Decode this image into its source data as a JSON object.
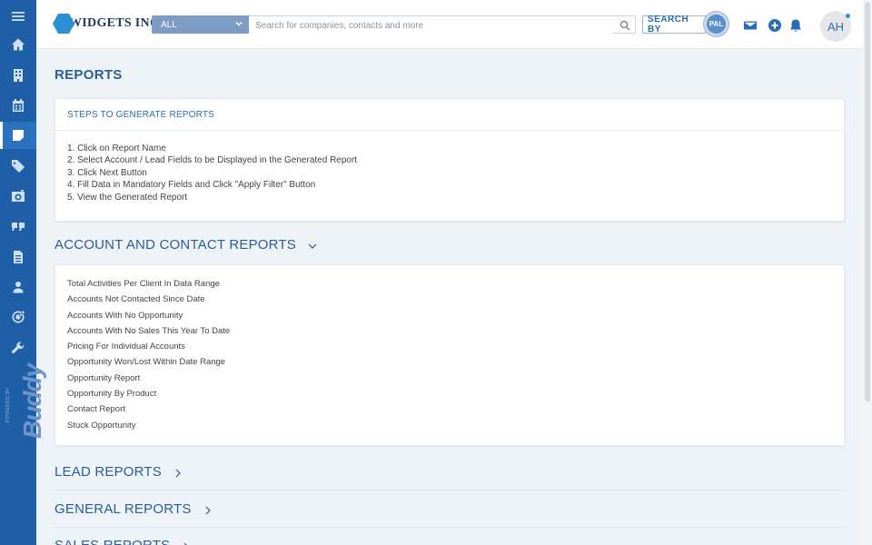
{
  "brand": {
    "name": "WIDGETS INC."
  },
  "topbar": {
    "scope_selected": "ALL",
    "search_placeholder": "Search for companies, contacts and more",
    "search_by_label": "SEARCH BY",
    "pal_label": "PAL",
    "avatar_initials": "AH"
  },
  "sidebar": {
    "items": [
      {
        "icon": "home-icon"
      },
      {
        "icon": "building-icon"
      },
      {
        "icon": "calendar-icon"
      },
      {
        "icon": "notes-icon",
        "active": true
      },
      {
        "icon": "tag-icon"
      },
      {
        "icon": "camera-icon"
      },
      {
        "icon": "quote-icon"
      },
      {
        "icon": "document-icon"
      },
      {
        "icon": "user-icon"
      },
      {
        "icon": "target-icon"
      },
      {
        "icon": "wrench-icon"
      }
    ],
    "powered_small": "POWERED BY",
    "powered_brand": "Buddy"
  },
  "main": {
    "page_title": "REPORTS",
    "steps_card": {
      "title": "STEPS TO GENERATE REPORTS",
      "steps": [
        "1. Click on Report Name",
        "2. Select Account / Lead Fields to be Displayed in the Generated Report",
        "3. Click Next Button",
        "4. Fill Data in Mandatory Fields and Click \"Apply Filter\" Button",
        "5. View the Generated Report"
      ]
    },
    "sections": [
      {
        "title": "ACCOUNT AND CONTACT REPORTS",
        "expanded": true,
        "reports": [
          "Total Activities Per Client In Data Range",
          "Accounts Not Contacted Since Date",
          "Accounts With No Opportunity",
          "Accounts With No Sales This Year To Date",
          "Pricing For Individual Accounts",
          "Opportunity Won/Lost Within Date Range",
          "Opportunity Report",
          "Opportunity By Product",
          "Contact Report",
          "Stuck Opportunity"
        ]
      },
      {
        "title": "LEAD REPORTS",
        "expanded": false
      },
      {
        "title": "GENERAL REPORTS",
        "expanded": false
      },
      {
        "title": "SALES REPORTS",
        "expanded": false
      }
    ]
  },
  "colors": {
    "sidebar_bg": "#1f5fa8",
    "accent": "#2a6db5",
    "heading": "#2a5d9a",
    "page_bg": "#eef3f8"
  }
}
